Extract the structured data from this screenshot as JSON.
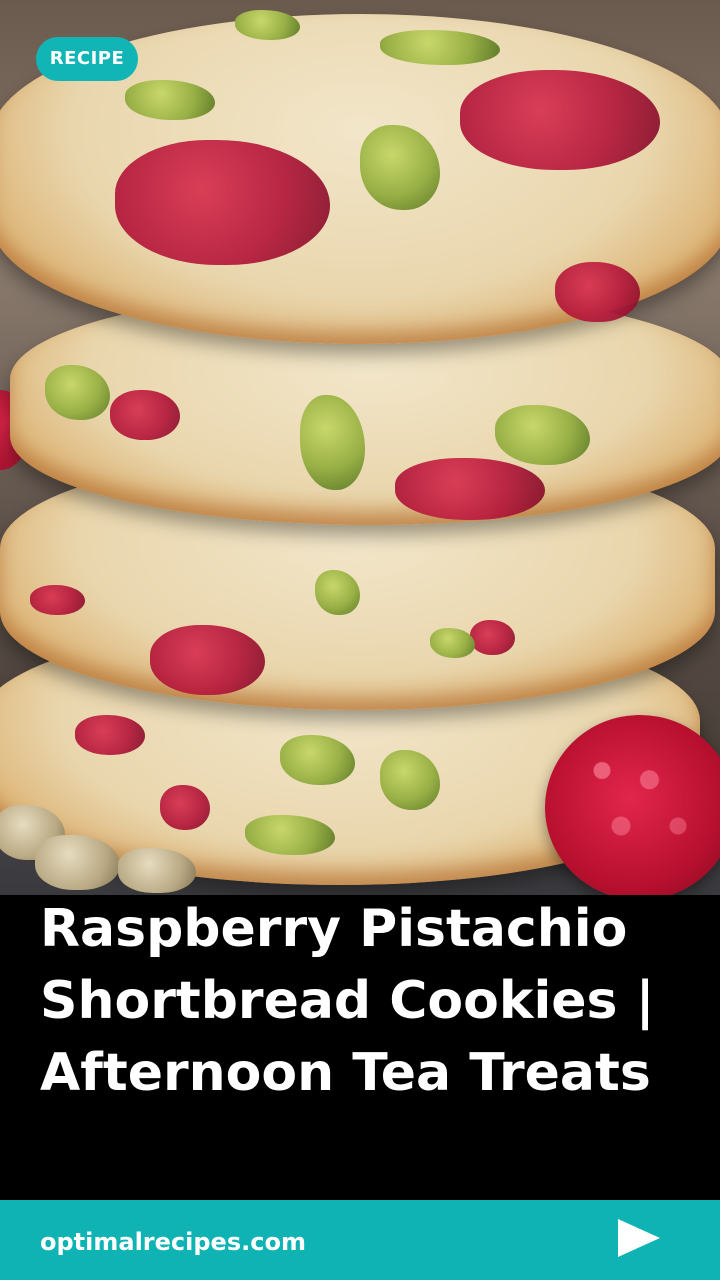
{
  "badge": {
    "label": "RECIPE"
  },
  "title": {
    "lines": [
      "Raspberry Pistachio",
      "Shortbread Cookies |",
      "Afternoon Tea Treats"
    ]
  },
  "footer": {
    "site": "optimalrecipes.com",
    "play_icon": "play-arrow-icon"
  },
  "colors": {
    "accent": "#12b5b5",
    "title_text": "#ffffff",
    "background": "#000000"
  }
}
